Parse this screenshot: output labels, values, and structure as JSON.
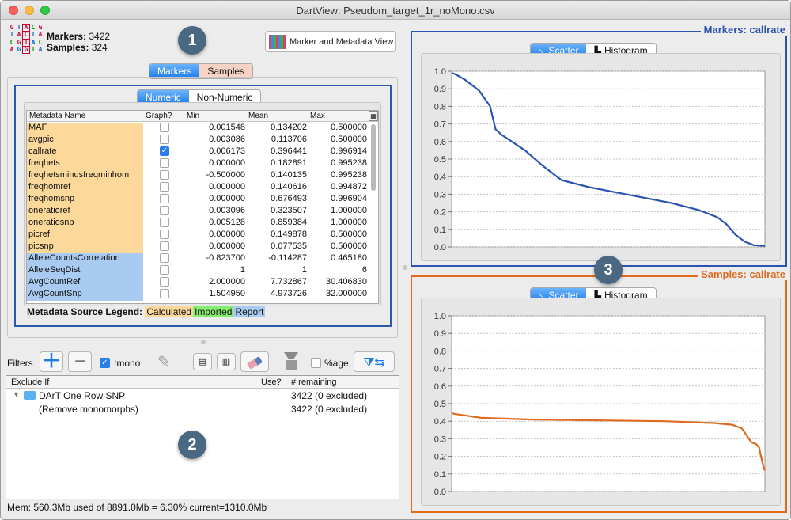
{
  "window": {
    "title": "DartView: Pseudom_target_1r_noMono.csv"
  },
  "stats": {
    "markers_label": "Markers:",
    "markers_value": "3422",
    "samples_label": "Samples:",
    "samples_value": "324"
  },
  "badges": {
    "one": "1",
    "two": "2",
    "three": "3"
  },
  "header": {
    "view_button": "Marker and Metadata View"
  },
  "tabs": {
    "markers": "Markers",
    "samples": "Samples"
  },
  "subtabs": {
    "numeric": "Numeric",
    "non_numeric": "Non-Numeric"
  },
  "table": {
    "headers": {
      "name": "Metadata Name",
      "graph": "Graph?",
      "min": "Min",
      "mean": "Mean",
      "max": "Max"
    },
    "rows": [
      {
        "name": "MAF",
        "source": "calc",
        "graph": false,
        "min": "0.001548",
        "mean": "0.134202",
        "max": "0.500000"
      },
      {
        "name": "avgpic",
        "source": "calc",
        "graph": false,
        "min": "0.003086",
        "mean": "0.113706",
        "max": "0.500000"
      },
      {
        "name": "callrate",
        "source": "calc",
        "graph": true,
        "min": "0.006173",
        "mean": "0.396441",
        "max": "0.996914"
      },
      {
        "name": "freqhets",
        "source": "calc",
        "graph": false,
        "min": "0.000000",
        "mean": "0.182891",
        "max": "0.995238"
      },
      {
        "name": "freqhetsminusfreqminhom",
        "source": "calc",
        "graph": false,
        "min": "-0.500000",
        "mean": "0.140135",
        "max": "0.995238"
      },
      {
        "name": "freqhomref",
        "source": "calc",
        "graph": false,
        "min": "0.000000",
        "mean": "0.140616",
        "max": "0.994872"
      },
      {
        "name": "freqhomsnp",
        "source": "calc",
        "graph": false,
        "min": "0.000000",
        "mean": "0.676493",
        "max": "0.996904"
      },
      {
        "name": "oneratioref",
        "source": "calc",
        "graph": false,
        "min": "0.003096",
        "mean": "0.323507",
        "max": "1.000000"
      },
      {
        "name": "oneratiosnp",
        "source": "calc",
        "graph": false,
        "min": "0.005128",
        "mean": "0.859384",
        "max": "1.000000"
      },
      {
        "name": "picref",
        "source": "calc",
        "graph": false,
        "min": "0.000000",
        "mean": "0.149878",
        "max": "0.500000"
      },
      {
        "name": "picsnp",
        "source": "calc",
        "graph": false,
        "min": "0.000000",
        "mean": "0.077535",
        "max": "0.500000"
      },
      {
        "name": "AlleleCountsCorrelation",
        "source": "rep",
        "graph": false,
        "min": "-0.823700",
        "mean": "-0.114287",
        "max": "0.465180"
      },
      {
        "name": "AlleleSeqDist",
        "source": "rep",
        "graph": false,
        "min": "1",
        "mean": "1",
        "max": "6"
      },
      {
        "name": "AvgCountRef",
        "source": "rep",
        "graph": false,
        "min": "2.000000",
        "mean": "7.732867",
        "max": "30.406830"
      },
      {
        "name": "AvgCountSnp",
        "source": "rep",
        "graph": false,
        "min": "1.504950",
        "mean": "4.973726",
        "max": "32.000000"
      }
    ]
  },
  "legend": {
    "label": "Metadata Source Legend:",
    "calculated": "Calculated",
    "imported": "Imported",
    "report": "Report"
  },
  "colors": {
    "calculated": "#fcd89a",
    "imported": "#86ef6f",
    "report": "#a9cbf2",
    "markers_line": "#2a54b0",
    "samples_line": "#e06a20",
    "accent": "#1d7bea"
  },
  "filters": {
    "label": "Filters",
    "mono_label": "!mono",
    "age_label": "%age",
    "headers": {
      "exclude": "Exclude If",
      "use": "Use?",
      "remaining": "# remaining"
    },
    "items": [
      {
        "name": "DArT One Row SNP",
        "remaining": "3422 (0 excluded)"
      },
      {
        "name": "(Remove monomorphs)",
        "remaining": "3422 (0 excluded)"
      }
    ]
  },
  "status": "Mem: 560.3Mb used of 8891.0Mb =  6.30% current=1310.0Mb",
  "charts": {
    "scatter_label": "Scatter",
    "histogram_label": "Histogram",
    "markers_title": "Markers: callrate",
    "samples_title": "Samples: callrate"
  },
  "chart_data": [
    {
      "type": "line",
      "title": "Markers: callrate",
      "ylim": [
        0,
        1.0
      ],
      "yticks": [
        "0.0",
        "0.1",
        "0.2",
        "0.3",
        "0.4",
        "0.5",
        "0.6",
        "0.7",
        "0.8",
        "0.9",
        "1.0"
      ],
      "grid": true,
      "series": [
        {
          "x": [
            0,
            50,
            150,
            300,
            420,
            480,
            540,
            600,
            800,
            1000,
            1200,
            1500,
            1800,
            2100,
            2400,
            2700,
            2900,
            3000,
            3100,
            3200,
            3300,
            3422
          ],
          "y": [
            0.99,
            0.98,
            0.95,
            0.89,
            0.8,
            0.67,
            0.64,
            0.62,
            0.55,
            0.46,
            0.38,
            0.34,
            0.31,
            0.28,
            0.25,
            0.21,
            0.17,
            0.13,
            0.07,
            0.03,
            0.01,
            0.006
          ]
        }
      ]
    },
    {
      "type": "line",
      "title": "Samples: callrate",
      "ylim": [
        0,
        1.0
      ],
      "yticks": [
        "0.0",
        "0.1",
        "0.2",
        "0.3",
        "0.4",
        "0.5",
        "0.6",
        "0.7",
        "0.8",
        "0.9",
        "1.0"
      ],
      "grid": true,
      "series": [
        {
          "x": [
            0,
            5,
            30,
            80,
            150,
            220,
            270,
            290,
            300,
            305,
            310,
            315,
            318,
            320,
            322,
            324
          ],
          "y": [
            0.445,
            0.44,
            0.42,
            0.41,
            0.405,
            0.4,
            0.39,
            0.38,
            0.36,
            0.32,
            0.28,
            0.27,
            0.25,
            0.2,
            0.15,
            0.12
          ]
        }
      ]
    }
  ]
}
